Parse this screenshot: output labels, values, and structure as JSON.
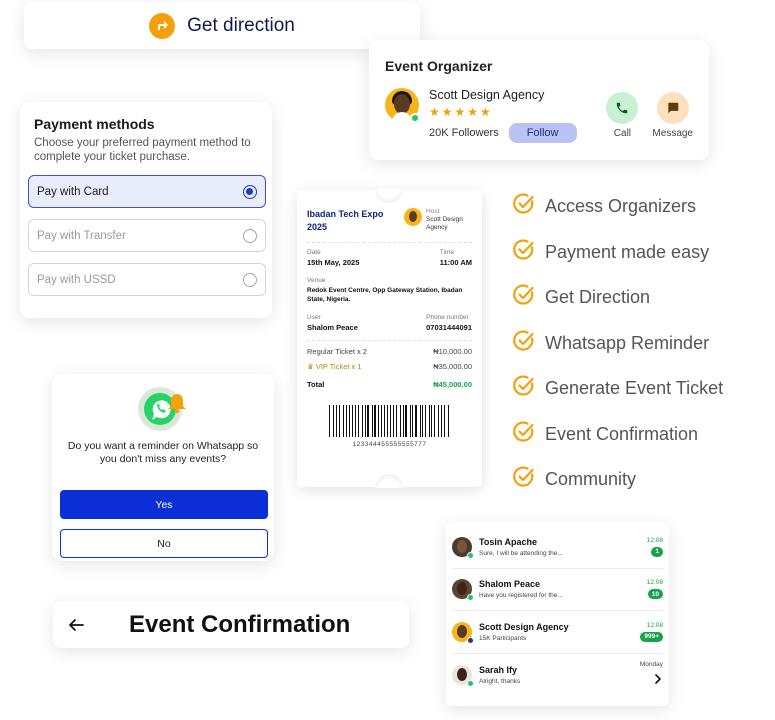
{
  "direction": {
    "label": "Get direction"
  },
  "organizer": {
    "title": "Event Organizer",
    "name": "Scott Design Agency",
    "stars": "★★★★★",
    "followers": "20K Followers",
    "follow_label": "Follow",
    "call_label": "Call",
    "message_label": "Message"
  },
  "payment": {
    "title": "Payment methods",
    "subtitle": "Choose your preferred payment method to complete your ticket purchase.",
    "options": [
      {
        "label": "Pay with Card",
        "selected": true
      },
      {
        "label": "Pay with Transfer",
        "selected": false
      },
      {
        "label": "Pay with USSD",
        "selected": false
      }
    ]
  },
  "ticket": {
    "event": "Ibadan Tech Expo 2025",
    "host_label": "Host",
    "host_name": "Scott Design Agency",
    "date_label": "Date",
    "date": "15th May, 2025",
    "time_label": "Time",
    "time": "11:00 AM",
    "venue_label": "Venue",
    "venue": "Redok Event Centre, Opp Gateway Station, Ibadan State, Nigeria.",
    "user_label": "User",
    "user": "Shalom Peace",
    "phone_label": "Phone number",
    "phone": "07031444091",
    "items": [
      {
        "label": "Regular Ticket x 2",
        "price": "₦10,000.00"
      },
      {
        "label": "VIP Ticket x 1",
        "price": "₦35,000.00"
      }
    ],
    "vip_icon": "crown-icon",
    "total_label": "Total",
    "total": "₦45,000.00",
    "barcode_number": "123344455555555777"
  },
  "features": [
    "Access Organizers",
    "Payment made easy",
    "Get Direction",
    "Whatsapp Reminder",
    "Generate Event Ticket",
    "Event Confirmation",
    "Community"
  ],
  "whatsapp": {
    "question": "Do you want a reminder on Whatsapp so you don't miss any events?",
    "yes_label": "Yes",
    "no_label": "No"
  },
  "confirmation": {
    "title": "Event Confirmation"
  },
  "chats": [
    {
      "name": "Tosin Apache",
      "message": "Sure, I will be attending the...",
      "time": "12:08",
      "badge": "1"
    },
    {
      "name": "Shalom Peace",
      "message": "Have you registered for the...",
      "time": "12:08",
      "badge": "10"
    },
    {
      "name": "Scott Design Agency",
      "message": "15K Participants",
      "time": "12:08",
      "badge": "999+"
    },
    {
      "name": "Sarah Ify",
      "message": "Alright, thanks",
      "time": "Monday",
      "badge": ""
    }
  ],
  "colors": {
    "accent_orange": "#f5a00b",
    "primary_blue": "#0a2fd6",
    "success_green": "#16a34a",
    "navy": "#0f1b4d"
  }
}
